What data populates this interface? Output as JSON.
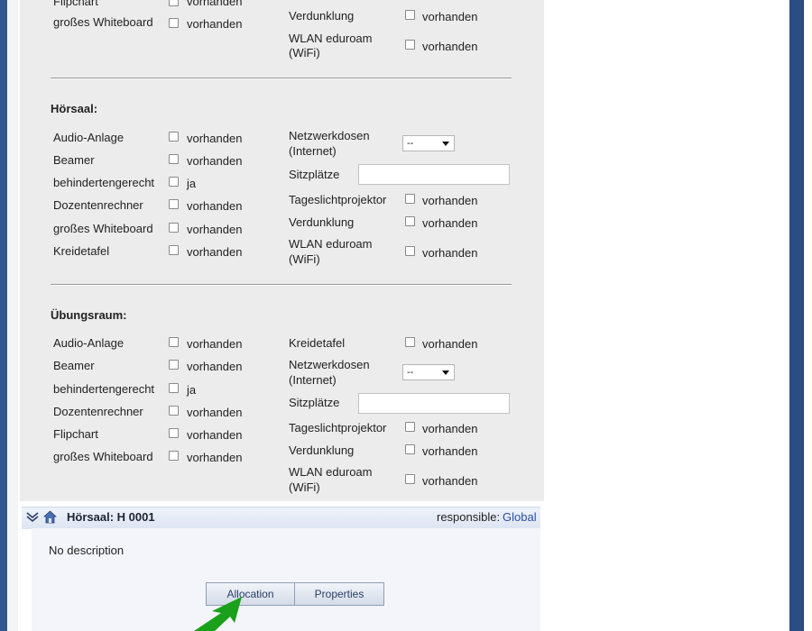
{
  "lists": {
    "top_left": [
      {
        "label": "Flipchart",
        "value": "vorhanden"
      },
      {
        "label": "großes Whiteboard",
        "value": "vorhanden"
      }
    ],
    "top_right": [
      {
        "label": "Verdunklung",
        "value": "vorhanden"
      },
      {
        "label": "WLAN eduroam (WiFi)",
        "label1": "WLAN eduroam",
        "label2": "(WiFi)",
        "value": "vorhanden"
      }
    ],
    "hoersaal": {
      "title": "Hörsaal:",
      "left": [
        {
          "label": "Audio-Anlage",
          "value": "vorhanden"
        },
        {
          "label": "Beamer",
          "value": "vorhanden"
        },
        {
          "label": "behindertengerecht",
          "value": "ja"
        },
        {
          "label": "Dozentenrechner",
          "value": "vorhanden"
        },
        {
          "label": "großes Whiteboard",
          "value": "vorhanden"
        },
        {
          "label": "Kreidetafel",
          "value": "vorhanden"
        }
      ],
      "right": [
        {
          "label1": "Netzwerkdosen",
          "label2": "(Internet)",
          "select": "--"
        },
        {
          "label": "Sitzplätze",
          "input": ""
        },
        {
          "label": "Tageslichtprojektor",
          "value": "vorhanden"
        },
        {
          "label": "Verdunklung",
          "value": "vorhanden"
        },
        {
          "label1": "WLAN eduroam",
          "label2": "(WiFi)",
          "value": "vorhanden"
        }
      ]
    },
    "uebungsraum": {
      "title": "Übungsraum:",
      "left": [
        {
          "label": "Audio-Anlage",
          "value": "vorhanden"
        },
        {
          "label": "Beamer",
          "value": "vorhanden"
        },
        {
          "label": "behindertengerecht",
          "value": "ja"
        },
        {
          "label": "Dozentenrechner",
          "value": "vorhanden"
        },
        {
          "label": "Flipchart",
          "value": "vorhanden"
        },
        {
          "label": "großes Whiteboard",
          "value": "vorhanden"
        }
      ],
      "right": [
        {
          "label": "Kreidetafel",
          "value": "vorhanden"
        },
        {
          "label1": "Netzwerkdosen",
          "label2": "(Internet)",
          "select": "--"
        },
        {
          "label": "Sitzplätze",
          "input": ""
        },
        {
          "label": "Tageslichtprojektor",
          "value": "vorhanden"
        },
        {
          "label": "Verdunklung",
          "value": "vorhanden"
        },
        {
          "label1": "WLAN eduroam",
          "label2": "(WiFi)",
          "value": "vorhanden"
        }
      ]
    }
  },
  "room": {
    "title": "Hörsaal: H 0001",
    "responsible_label": "responsible:",
    "responsible_value": "Global",
    "description": "No description"
  },
  "tabs": {
    "allocation": "Allocation",
    "properties": "Properties"
  },
  "colors": {
    "link": "#2a4fa8",
    "arrow": "#1aa01a",
    "frame": "#2b4c84"
  }
}
